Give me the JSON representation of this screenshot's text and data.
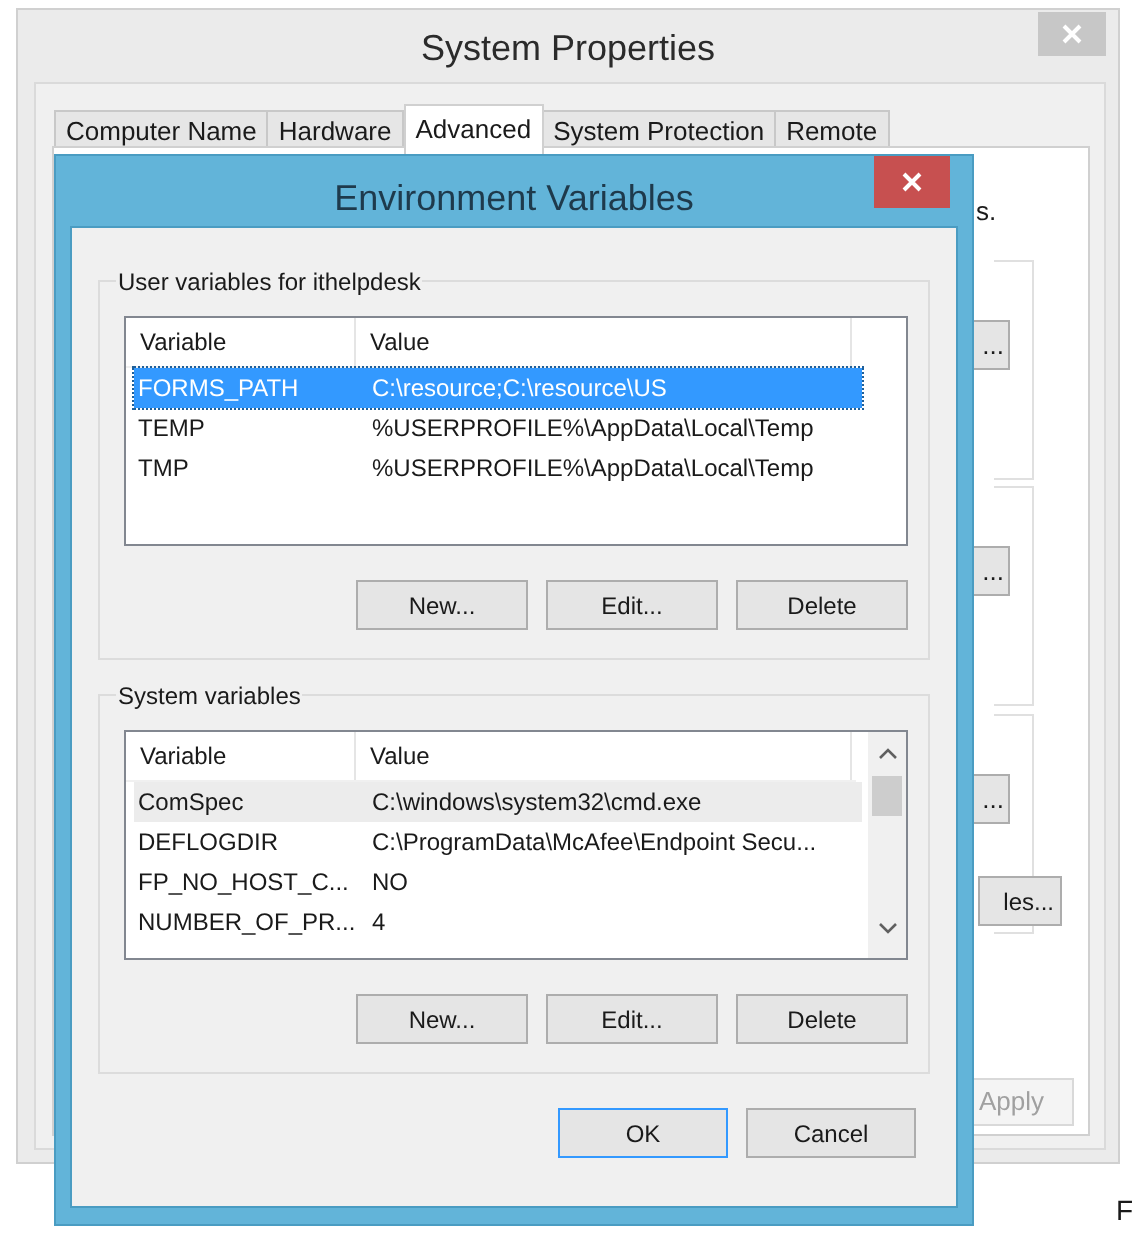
{
  "back_window": {
    "title": "System Properties",
    "tabs": [
      {
        "label": "Computer Name",
        "selected": false
      },
      {
        "label": "Hardware",
        "selected": false
      },
      {
        "label": "Advanced",
        "selected": true
      },
      {
        "label": "System Protection",
        "selected": false
      },
      {
        "label": "Remote",
        "selected": false
      }
    ],
    "panel_text": "s.",
    "panel_buttons": [
      "...",
      "...",
      "..."
    ],
    "env_button": "les...",
    "apply_button": {
      "label": "Apply",
      "disabled": true
    },
    "edge_text": "F"
  },
  "dialog": {
    "title": "Environment Variables",
    "groups": [
      {
        "label": "User variables for ithelpdesk",
        "focused": true,
        "scrollbar": false,
        "columns": [
          "Variable",
          "Value"
        ],
        "rows": [
          {
            "variable": "FORMS_PATH",
            "value": "C:\\resource;C:\\resource\\US",
            "selected": true
          },
          {
            "variable": "TEMP",
            "value": "%USERPROFILE%\\AppData\\Local\\Temp",
            "selected": false
          },
          {
            "variable": "TMP",
            "value": "%USERPROFILE%\\AppData\\Local\\Temp",
            "selected": false
          }
        ],
        "buttons": [
          "New...",
          "Edit...",
          "Delete"
        ]
      },
      {
        "label": "System variables",
        "focused": false,
        "scrollbar": true,
        "columns": [
          "Variable",
          "Value"
        ],
        "rows": [
          {
            "variable": "ComSpec",
            "value": "C:\\windows\\system32\\cmd.exe",
            "selected": true
          },
          {
            "variable": "DEFLOGDIR",
            "value": "C:\\ProgramData\\McAfee\\Endpoint Secu...",
            "selected": false
          },
          {
            "variable": "FP_NO_HOST_C...",
            "value": "NO",
            "selected": false
          },
          {
            "variable": "NUMBER_OF_PR...",
            "value": "4",
            "selected": false
          }
        ],
        "buttons": [
          "New...",
          "Edit...",
          "Delete"
        ]
      }
    ],
    "buttons": [
      {
        "label": "OK",
        "default": true
      },
      {
        "label": "Cancel",
        "default": false
      }
    ]
  }
}
